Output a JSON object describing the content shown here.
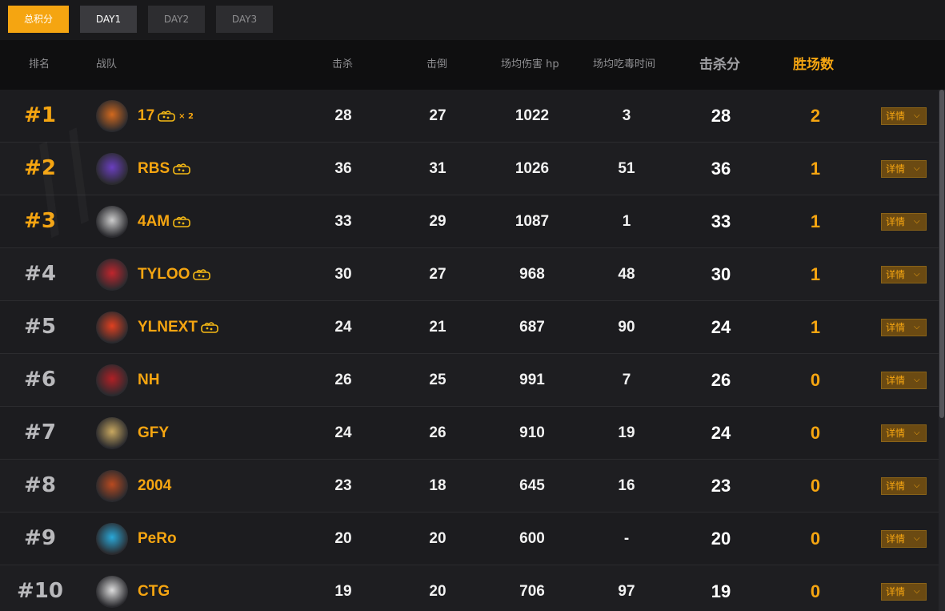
{
  "tabs": [
    {
      "label": "总积分",
      "state": "active"
    },
    {
      "label": "DAY1",
      "state": "selected"
    },
    {
      "label": "DAY2",
      "state": "normal"
    },
    {
      "label": "DAY3",
      "state": "normal"
    }
  ],
  "headers": {
    "rank": "排名",
    "team": "战队",
    "kills": "击杀",
    "knocks": "击倒",
    "avg_damage": "场均伤害 hp",
    "avg_poison_time": "场均吃毒时间",
    "kill_score": "击杀分",
    "wins": "胜场数"
  },
  "detail_label": "详情",
  "chicken_icon": "chicken-dinner-icon",
  "colors": {
    "accent": "#f5a511",
    "background": "#1a1a1c",
    "header_bg": "#0f0f10"
  },
  "rows": [
    {
      "rank": "#1",
      "team": "17",
      "chicken": true,
      "multiplier": "× 2",
      "kills": "28",
      "knocks": "27",
      "damage": "1022",
      "poison": "3",
      "kill_score": "28",
      "wins": "2"
    },
    {
      "rank": "#2",
      "team": "RBS",
      "chicken": true,
      "multiplier": "",
      "kills": "36",
      "knocks": "31",
      "damage": "1026",
      "poison": "51",
      "kill_score": "36",
      "wins": "1"
    },
    {
      "rank": "#3",
      "team": "4AM",
      "chicken": true,
      "multiplier": "",
      "kills": "33",
      "knocks": "29",
      "damage": "1087",
      "poison": "1",
      "kill_score": "33",
      "wins": "1"
    },
    {
      "rank": "#4",
      "team": "TYLOO",
      "chicken": true,
      "multiplier": "",
      "kills": "30",
      "knocks": "27",
      "damage": "968",
      "poison": "48",
      "kill_score": "30",
      "wins": "1"
    },
    {
      "rank": "#5",
      "team": "YLNEXT",
      "chicken": true,
      "multiplier": "",
      "kills": "24",
      "knocks": "21",
      "damage": "687",
      "poison": "90",
      "kill_score": "24",
      "wins": "1"
    },
    {
      "rank": "#6",
      "team": "NH",
      "chicken": false,
      "multiplier": "",
      "kills": "26",
      "knocks": "25",
      "damage": "991",
      "poison": "7",
      "kill_score": "26",
      "wins": "0"
    },
    {
      "rank": "#7",
      "team": "GFY",
      "chicken": false,
      "multiplier": "",
      "kills": "24",
      "knocks": "26",
      "damage": "910",
      "poison": "19",
      "kill_score": "24",
      "wins": "0"
    },
    {
      "rank": "#8",
      "team": "2004",
      "chicken": false,
      "multiplier": "",
      "kills": "23",
      "knocks": "18",
      "damage": "645",
      "poison": "16",
      "kill_score": "23",
      "wins": "0"
    },
    {
      "rank": "#9",
      "team": "PeRo",
      "chicken": false,
      "multiplier": "",
      "kills": "20",
      "knocks": "20",
      "damage": "600",
      "poison": "-",
      "kill_score": "20",
      "wins": "0"
    },
    {
      "rank": "#10",
      "team": "CTG",
      "chicken": false,
      "multiplier": "",
      "kills": "19",
      "knocks": "20",
      "damage": "706",
      "poison": "97",
      "kill_score": "19",
      "wins": "0"
    }
  ]
}
